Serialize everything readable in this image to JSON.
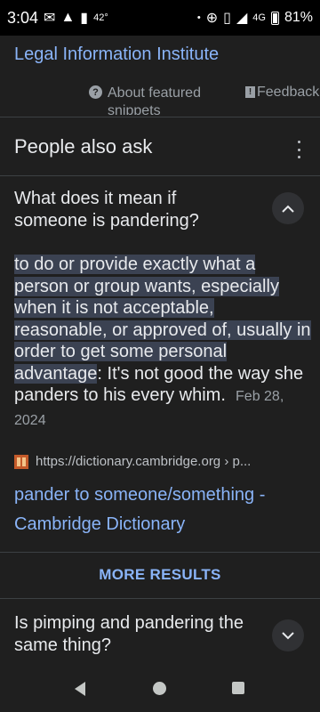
{
  "status_bar": {
    "time": "3:04",
    "temperature": "42°",
    "network": "4G",
    "battery": "81%"
  },
  "top_link": "Legal Information Institute",
  "snippet_meta": {
    "about": "About featured snippets",
    "feedback": "Feedback"
  },
  "paa": {
    "title": "People also ask",
    "question_1": "What does it mean if someone is pandering?",
    "answer_highlight": "to do or provide exactly what a person or group wants, especially when it is not acceptable, reasonable, or approved of, usually in order to get some personal advantage",
    "answer_colon": ":",
    "answer_rest": " It's not good the way she panders to his every whim.",
    "answer_date": "Feb 28, 2024",
    "source_url": "https://dictionary.cambridge.org › p...",
    "result_title": "pander to someone/something - Cambridge Dictionary",
    "more_results": "MORE RESULTS",
    "question_2": "Is pimping and pandering the same thing?"
  },
  "icons": {
    "chevron_up": "chevron-up-icon",
    "chevron_down": "chevron-down-icon",
    "more": "more-vert-icon"
  },
  "colors": {
    "background": "#1f1f1f",
    "link": "#8ab4f8",
    "highlight": "#3b4252"
  }
}
